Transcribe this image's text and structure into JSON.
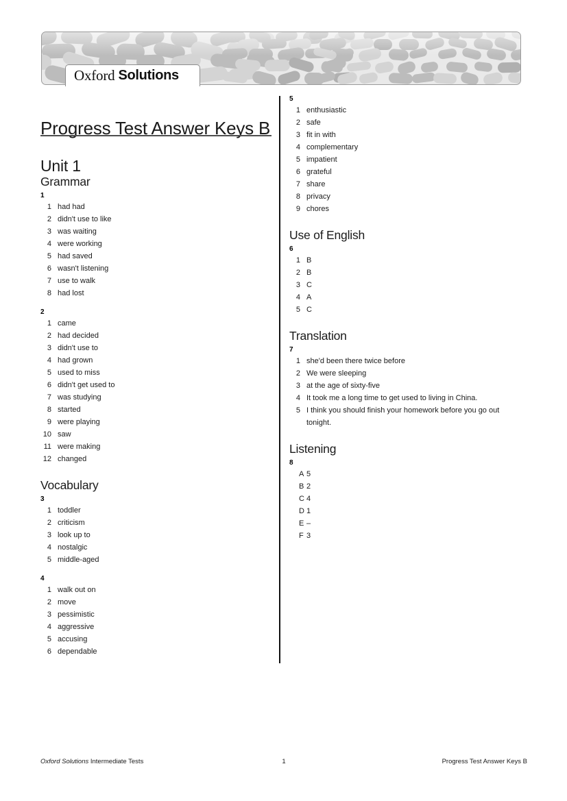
{
  "header": {
    "logo_oxford": "Oxford",
    "logo_solutions": "Solutions"
  },
  "document": {
    "title": "Progress Test Answer Keys B",
    "unit": "Unit 1"
  },
  "left_column": {
    "sections": [
      {
        "heading": "Grammar",
        "exercises": [
          {
            "number": "1",
            "marker_type": "number",
            "items": [
              {
                "marker": "1",
                "value": "had had"
              },
              {
                "marker": "2",
                "value": "didn't use to like"
              },
              {
                "marker": "3",
                "value": "was waiting"
              },
              {
                "marker": "4",
                "value": "were working"
              },
              {
                "marker": "5",
                "value": "had saved"
              },
              {
                "marker": "6",
                "value": "wasn't listening"
              },
              {
                "marker": "7",
                "value": "use to walk"
              },
              {
                "marker": "8",
                "value": "had lost"
              }
            ]
          },
          {
            "number": "2",
            "marker_type": "number",
            "items": [
              {
                "marker": "1",
                "value": "came"
              },
              {
                "marker": "2",
                "value": "had decided"
              },
              {
                "marker": "3",
                "value": "didn't use to"
              },
              {
                "marker": "4",
                "value": "had grown"
              },
              {
                "marker": "5",
                "value": "used to miss"
              },
              {
                "marker": "6",
                "value": "didn't get used to"
              },
              {
                "marker": "7",
                "value": "was studying"
              },
              {
                "marker": "8",
                "value": "started"
              },
              {
                "marker": "9",
                "value": "were playing"
              },
              {
                "marker": "10",
                "value": "saw"
              },
              {
                "marker": "11",
                "value": "were making"
              },
              {
                "marker": "12",
                "value": "changed"
              }
            ]
          }
        ]
      },
      {
        "heading": "Vocabulary",
        "exercises": [
          {
            "number": "3",
            "marker_type": "number",
            "items": [
              {
                "marker": "1",
                "value": "toddler"
              },
              {
                "marker": "2",
                "value": "criticism"
              },
              {
                "marker": "3",
                "value": "look up to"
              },
              {
                "marker": "4",
                "value": "nostalgic"
              },
              {
                "marker": "5",
                "value": "middle-aged"
              }
            ]
          },
          {
            "number": "4",
            "marker_type": "number",
            "items": [
              {
                "marker": "1",
                "value": "walk out on"
              },
              {
                "marker": "2",
                "value": "move"
              },
              {
                "marker": "3",
                "value": "pessimistic"
              },
              {
                "marker": "4",
                "value": "aggressive"
              },
              {
                "marker": "5",
                "value": "accusing"
              },
              {
                "marker": "6",
                "value": "dependable"
              }
            ]
          }
        ]
      }
    ]
  },
  "right_column": {
    "sections": [
      {
        "heading": "",
        "exercises": [
          {
            "number": "5",
            "marker_type": "number",
            "items": [
              {
                "marker": "1",
                "value": "enthusiastic"
              },
              {
                "marker": "2",
                "value": "safe"
              },
              {
                "marker": "3",
                "value": "fit in with"
              },
              {
                "marker": "4",
                "value": "complementary"
              },
              {
                "marker": "5",
                "value": "impatient"
              },
              {
                "marker": "6",
                "value": "grateful"
              },
              {
                "marker": "7",
                "value": "share"
              },
              {
                "marker": "8",
                "value": "privacy"
              },
              {
                "marker": "9",
                "value": "chores"
              }
            ]
          }
        ]
      },
      {
        "heading": "Use of English",
        "exercises": [
          {
            "number": "6",
            "marker_type": "number",
            "items": [
              {
                "marker": "1",
                "value": "B"
              },
              {
                "marker": "2",
                "value": "B"
              },
              {
                "marker": "3",
                "value": "C"
              },
              {
                "marker": "4",
                "value": "A"
              },
              {
                "marker": "5",
                "value": "C"
              }
            ]
          }
        ]
      },
      {
        "heading": "Translation",
        "exercises": [
          {
            "number": "7",
            "marker_type": "number",
            "items": [
              {
                "marker": "1",
                "value": "she'd been there twice before"
              },
              {
                "marker": "2",
                "value": "We were sleeping"
              },
              {
                "marker": "3",
                "value": "at the age of sixty-five"
              },
              {
                "marker": "4",
                "value": "It took me a long time to get used to living in China."
              },
              {
                "marker": "5",
                "value": "I think you should finish your homework before you go out tonight."
              }
            ]
          }
        ]
      },
      {
        "heading": "Listening",
        "exercises": [
          {
            "number": "8",
            "marker_type": "letter",
            "items": [
              {
                "marker": "A",
                "value": "5"
              },
              {
                "marker": "B",
                "value": "2"
              },
              {
                "marker": "C",
                "value": "4"
              },
              {
                "marker": "D",
                "value": "1"
              },
              {
                "marker": "E",
                "value": "–"
              },
              {
                "marker": "F",
                "value": "3"
              }
            ]
          }
        ]
      }
    ]
  },
  "footer": {
    "left_italic": "Oxford Solutions",
    "left_rest": "Intermediate Tests",
    "page_number": "1",
    "right": "Progress Test Answer Keys B"
  }
}
